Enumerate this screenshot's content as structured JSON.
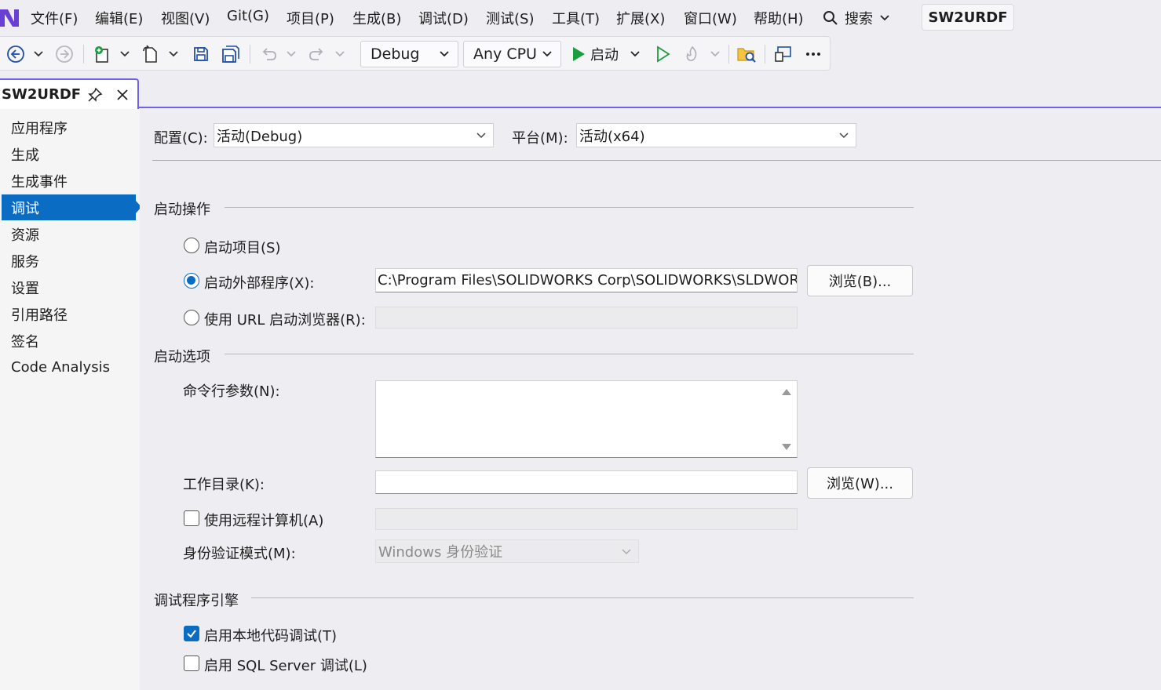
{
  "menu": {
    "items": [
      "文件(F)",
      "编辑(E)",
      "视图(V)",
      "Git(G)",
      "项目(P)",
      "生成(B)",
      "调试(D)",
      "测试(S)",
      "工具(T)",
      "扩展(X)",
      "窗口(W)",
      "帮助(H)"
    ],
    "search_label": "搜索",
    "solution_name": "SW2URDF"
  },
  "toolbar": {
    "configuration": "Debug",
    "platform": "Any CPU",
    "start_label": "启动"
  },
  "tab": {
    "title": "SW2URDF"
  },
  "nav": {
    "items": [
      "应用程序",
      "生成",
      "生成事件",
      "调试",
      "资源",
      "服务",
      "设置",
      "引用路径",
      "签名",
      "Code Analysis"
    ],
    "active": "调试"
  },
  "config": {
    "config_label": "配置(C):",
    "config_value": "活动(Debug)",
    "platform_label": "平台(M):",
    "platform_value": "活动(x64)"
  },
  "start_action": {
    "heading": "启动操作",
    "start_project": "启动项目(S)",
    "start_external": "启动外部程序(X):",
    "external_path": "C:\\Program Files\\SOLIDWORKS Corp\\SOLIDWORKS\\SLDWORKS.exe",
    "browse_b": "浏览(B)...",
    "start_url": "使用 URL 启动浏览器(R):",
    "selected": "start_external"
  },
  "start_options": {
    "heading": "启动选项",
    "cmd_args_label": "命令行参数(N):",
    "cmd_args_value": "",
    "work_dir_label": "工作目录(K):",
    "work_dir_value": "",
    "browse_w": "浏览(W)...",
    "remote_label": "使用远程计算机(A)",
    "remote_checked": false,
    "auth_label": "身份验证模式(M):",
    "auth_value": "Windows 身份验证"
  },
  "debug_engines": {
    "heading": "调试程序引擎",
    "native_label": "启用本地代码调试(T)",
    "native_checked": true,
    "sql_label": "启用 SQL Server 调试(L)",
    "sql_checked": false
  },
  "colors": {
    "accent": "#0b6cc4",
    "tab_border": "#7160e8",
    "start_green": "#1b9e3e"
  }
}
